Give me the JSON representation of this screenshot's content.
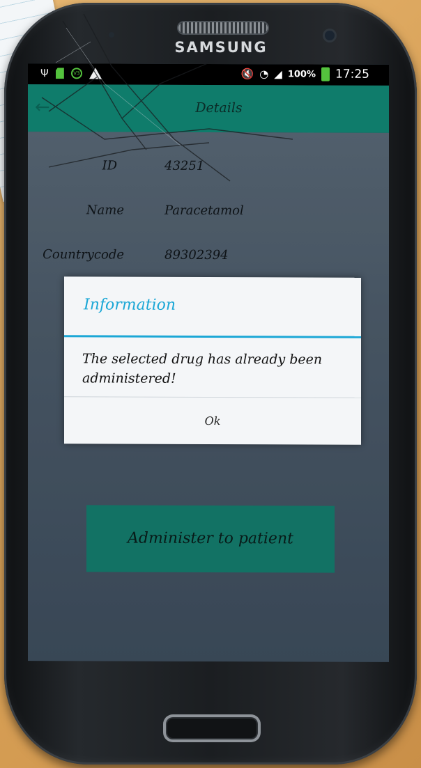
{
  "device": {
    "brand": "SAMSUNG"
  },
  "statusbar": {
    "battery_percent": "100%",
    "time": "17:25",
    "icons": [
      "usb-icon",
      "sd-card-icon",
      "v3-icon",
      "warning-icon",
      "mute-icon",
      "wifi-icon",
      "signal-icon",
      "battery-icon"
    ]
  },
  "appbar": {
    "title": "Details"
  },
  "details": {
    "id_label": "ID",
    "id_value": "43251",
    "name_label": "Name",
    "name_value": "Paracetamol",
    "countrycode_label": "Countrycode",
    "countrycode_value": "89302394"
  },
  "dialog": {
    "title": "Information",
    "message": "The selected drug has already been administered!",
    "ok_label": "Ok"
  },
  "actions": {
    "administer_label": "Administer to patient"
  },
  "colors": {
    "appbar": "#0f7c6b",
    "dialog_accent": "#1ba7d6",
    "button": "#128270"
  }
}
